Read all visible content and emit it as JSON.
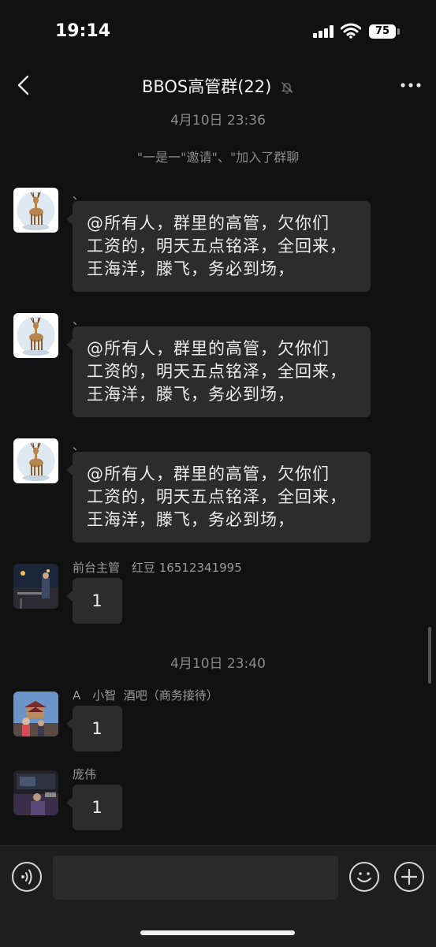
{
  "status": {
    "time": "19:14",
    "battery": "75"
  },
  "nav": {
    "title": "BBOS高管群(22)",
    "back_icon": "chevron-left-icon",
    "mute_icon": "bell-slash-icon",
    "more_icon": "ellipsis-icon"
  },
  "timestamps": [
    "4月10日 23:36",
    "4月10日 23:40"
  ],
  "system_message": "\"一是一\"邀请\"、\"加入了群聊",
  "messages": [
    {
      "sender": "、",
      "text": "@所有人，群里的高管，欠你们\n工资的，明天五点铭泽，全回来，\n王海洋，滕飞，务必到场，",
      "avatar": "deer-avatar"
    },
    {
      "sender": "、",
      "text": "@所有人，群里的高管，欠你们\n工资的，明天五点铭泽，全回来，\n王海洋，滕飞，务必到场，",
      "avatar": "deer-avatar"
    },
    {
      "sender": "、",
      "text": "@所有人，群里的高管，欠你们\n工资的，明天五点铭泽，全回来，\n王海洋，滕飞，务必到场，",
      "avatar": "deer-avatar"
    },
    {
      "sender": "前台主管　红豆 16512341995",
      "text": "1",
      "avatar": "night-street-avatar"
    },
    {
      "sender": "A　小智  酒吧（商务接待）",
      "text": "1",
      "avatar": "temple-avatar"
    },
    {
      "sender": "庞伟",
      "text": "1",
      "avatar": "car-interior-avatar"
    }
  ],
  "input_bar": {
    "placeholder": "",
    "voice_icon": "voice-icon",
    "emoji_icon": "emoji-icon",
    "plus_icon": "plus-icon"
  },
  "colors": {
    "background": "#111111",
    "bubble": "#2c2c2c",
    "meta_text": "#8a8a8a"
  }
}
